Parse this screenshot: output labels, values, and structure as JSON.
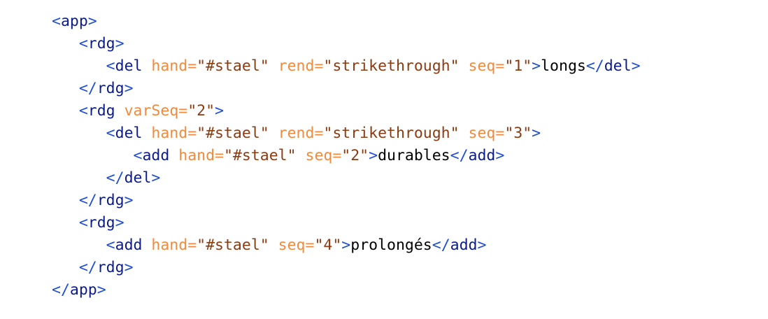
{
  "colors": {
    "bracket": "#1d4ed8",
    "element": "#0b1a8c",
    "attr_name": "#f08a3c",
    "attr_value": "#8a3b12",
    "text": "#000000",
    "background": "#ffffff"
  },
  "lines": [
    {
      "indent": 0,
      "tokens": [
        [
          "b",
          "<"
        ],
        [
          "el",
          "app"
        ],
        [
          "b",
          ">"
        ]
      ]
    },
    {
      "indent": 1,
      "tokens": [
        [
          "b",
          "<"
        ],
        [
          "el",
          "rdg"
        ],
        [
          "b",
          ">"
        ]
      ]
    },
    {
      "indent": 2,
      "tokens": [
        [
          "b",
          "<"
        ],
        [
          "el",
          "del"
        ],
        [
          "sp",
          " "
        ],
        [
          "an",
          "hand="
        ],
        [
          "av",
          "\"#stael\""
        ],
        [
          "sp",
          " "
        ],
        [
          "an",
          "rend="
        ],
        [
          "av",
          "\"strikethrough\""
        ],
        [
          "sp",
          " "
        ],
        [
          "an",
          "seq="
        ],
        [
          "av",
          "\"1\""
        ],
        [
          "b",
          ">"
        ],
        [
          "tx",
          "longs"
        ],
        [
          "b",
          "</"
        ],
        [
          "el",
          "del"
        ],
        [
          "b",
          ">"
        ]
      ]
    },
    {
      "indent": 1,
      "tokens": [
        [
          "b",
          "</"
        ],
        [
          "el",
          "rdg"
        ],
        [
          "b",
          ">"
        ]
      ]
    },
    {
      "indent": 1,
      "tokens": [
        [
          "b",
          "<"
        ],
        [
          "el",
          "rdg"
        ],
        [
          "sp",
          " "
        ],
        [
          "an",
          "varSeq="
        ],
        [
          "av",
          "\"2\""
        ],
        [
          "b",
          ">"
        ]
      ]
    },
    {
      "indent": 2,
      "tokens": [
        [
          "b",
          "<"
        ],
        [
          "el",
          "del"
        ],
        [
          "sp",
          " "
        ],
        [
          "an",
          "hand="
        ],
        [
          "av",
          "\"#stael\""
        ],
        [
          "sp",
          " "
        ],
        [
          "an",
          "rend="
        ],
        [
          "av",
          "\"strikethrough\""
        ],
        [
          "sp",
          " "
        ],
        [
          "an",
          "seq="
        ],
        [
          "av",
          "\"3\""
        ],
        [
          "b",
          ">"
        ]
      ]
    },
    {
      "indent": 3,
      "tokens": [
        [
          "b",
          "<"
        ],
        [
          "el",
          "add"
        ],
        [
          "sp",
          " "
        ],
        [
          "an",
          "hand="
        ],
        [
          "av",
          "\"#stael\""
        ],
        [
          "sp",
          " "
        ],
        [
          "an",
          "seq="
        ],
        [
          "av",
          "\"2\""
        ],
        [
          "b",
          ">"
        ],
        [
          "tx",
          "durables"
        ],
        [
          "b",
          "</"
        ],
        [
          "el",
          "add"
        ],
        [
          "b",
          ">"
        ]
      ]
    },
    {
      "indent": 2,
      "tokens": [
        [
          "b",
          "</"
        ],
        [
          "el",
          "del"
        ],
        [
          "b",
          ">"
        ]
      ]
    },
    {
      "indent": 1,
      "tokens": [
        [
          "b",
          "</"
        ],
        [
          "el",
          "rdg"
        ],
        [
          "b",
          ">"
        ]
      ]
    },
    {
      "indent": 1,
      "tokens": [
        [
          "b",
          "<"
        ],
        [
          "el",
          "rdg"
        ],
        [
          "b",
          ">"
        ]
      ]
    },
    {
      "indent": 2,
      "tokens": [
        [
          "b",
          "<"
        ],
        [
          "el",
          "add"
        ],
        [
          "sp",
          " "
        ],
        [
          "an",
          "hand="
        ],
        [
          "av",
          "\"#stael\""
        ],
        [
          "sp",
          " "
        ],
        [
          "an",
          "seq="
        ],
        [
          "av",
          "\"4\""
        ],
        [
          "b",
          ">"
        ],
        [
          "tx",
          "prolongés"
        ],
        [
          "b",
          "</"
        ],
        [
          "el",
          "add"
        ],
        [
          "b",
          ">"
        ]
      ]
    },
    {
      "indent": 1,
      "tokens": [
        [
          "b",
          "</"
        ],
        [
          "el",
          "rdg"
        ],
        [
          "b",
          ">"
        ]
      ]
    },
    {
      "indent": 0,
      "tokens": [
        [
          "b",
          "</"
        ],
        [
          "el",
          "app"
        ],
        [
          "b",
          ">"
        ]
      ]
    }
  ]
}
